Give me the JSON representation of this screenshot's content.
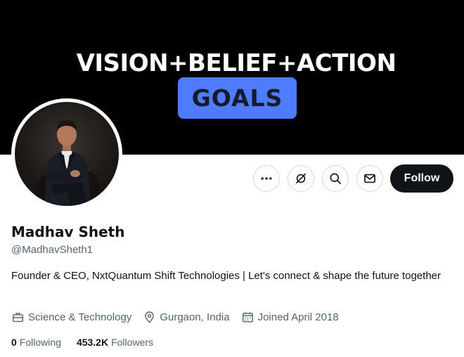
{
  "banner": {
    "headline": "VISION+BELIEF+ACTION",
    "goals_text": "GOALS",
    "goals_color": "#4f7cff"
  },
  "profile": {
    "name": "Madhav Sheth",
    "handle": "@MadhavSheth1",
    "bio": "Founder & CEO, NxtQuantum Shift Technologies | Let's connect & shape the future together",
    "category": "Science & Technology",
    "location": "Gurgaon, India",
    "joined": "Joined April 2018"
  },
  "stats": {
    "following_count": "0",
    "following_label": "Following",
    "followers_count": "453.2K",
    "followers_label": "Followers"
  },
  "actions": {
    "follow_label": "Follow",
    "icons": [
      "more-icon",
      "grok-icon",
      "search-icon",
      "message-icon"
    ]
  },
  "colors": {
    "text_primary": "#0f1419",
    "text_secondary": "#536471",
    "border": "#cfd9de"
  }
}
